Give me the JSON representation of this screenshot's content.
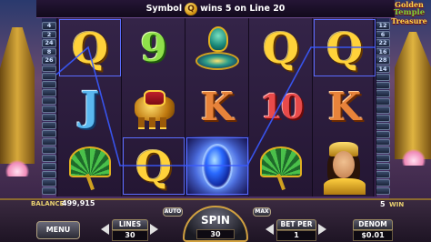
{
  "top_bar": {
    "message_prefix": "Symbol",
    "symbol_glyph": "Q",
    "message_suffix": "wins 5 on Line 20"
  },
  "logo": {
    "line1": "Golden",
    "line2": "Temple",
    "line3": "Treasure"
  },
  "paylines": {
    "left": [
      "4",
      "2",
      "24",
      "8",
      "26",
      "",
      "",
      "",
      "",
      "",
      "",
      "",
      "",
      "",
      "",
      "",
      "",
      "",
      "",
      "",
      ""
    ],
    "right": [
      "12",
      "6",
      "22",
      "16",
      "28",
      "14",
      "",
      "",
      "",
      "",
      "",
      "",
      "",
      "",
      "",
      "",
      "",
      "",
      "",
      "",
      ""
    ]
  },
  "reels": [
    [
      "Q",
      "J",
      "parasol"
    ],
    [
      "9",
      "elephant",
      "Q"
    ],
    [
      "snake",
      "K",
      "gem"
    ],
    [
      "Q",
      "10",
      "parasol"
    ],
    [
      "Q",
      "K",
      "princess"
    ]
  ],
  "bottom": {
    "balance_label": "BALANCE",
    "balance_value": "499,915",
    "win_value": "5",
    "win_label": "WIN",
    "menu_label": "MENU",
    "lines_label": "LINES",
    "lines_value": "30",
    "auto_label": "AUTO",
    "spin_label": "SPIN",
    "spin_value": "30",
    "max_label": "MAX",
    "bet_per_label": "BET PER",
    "bet_per_value": "1",
    "denom_label": "DENOM",
    "denom_value": "$0.01"
  },
  "colors": {
    "payline": "#3a5aff",
    "highlight": "#5b6cff",
    "gold": "#ffd23a"
  }
}
